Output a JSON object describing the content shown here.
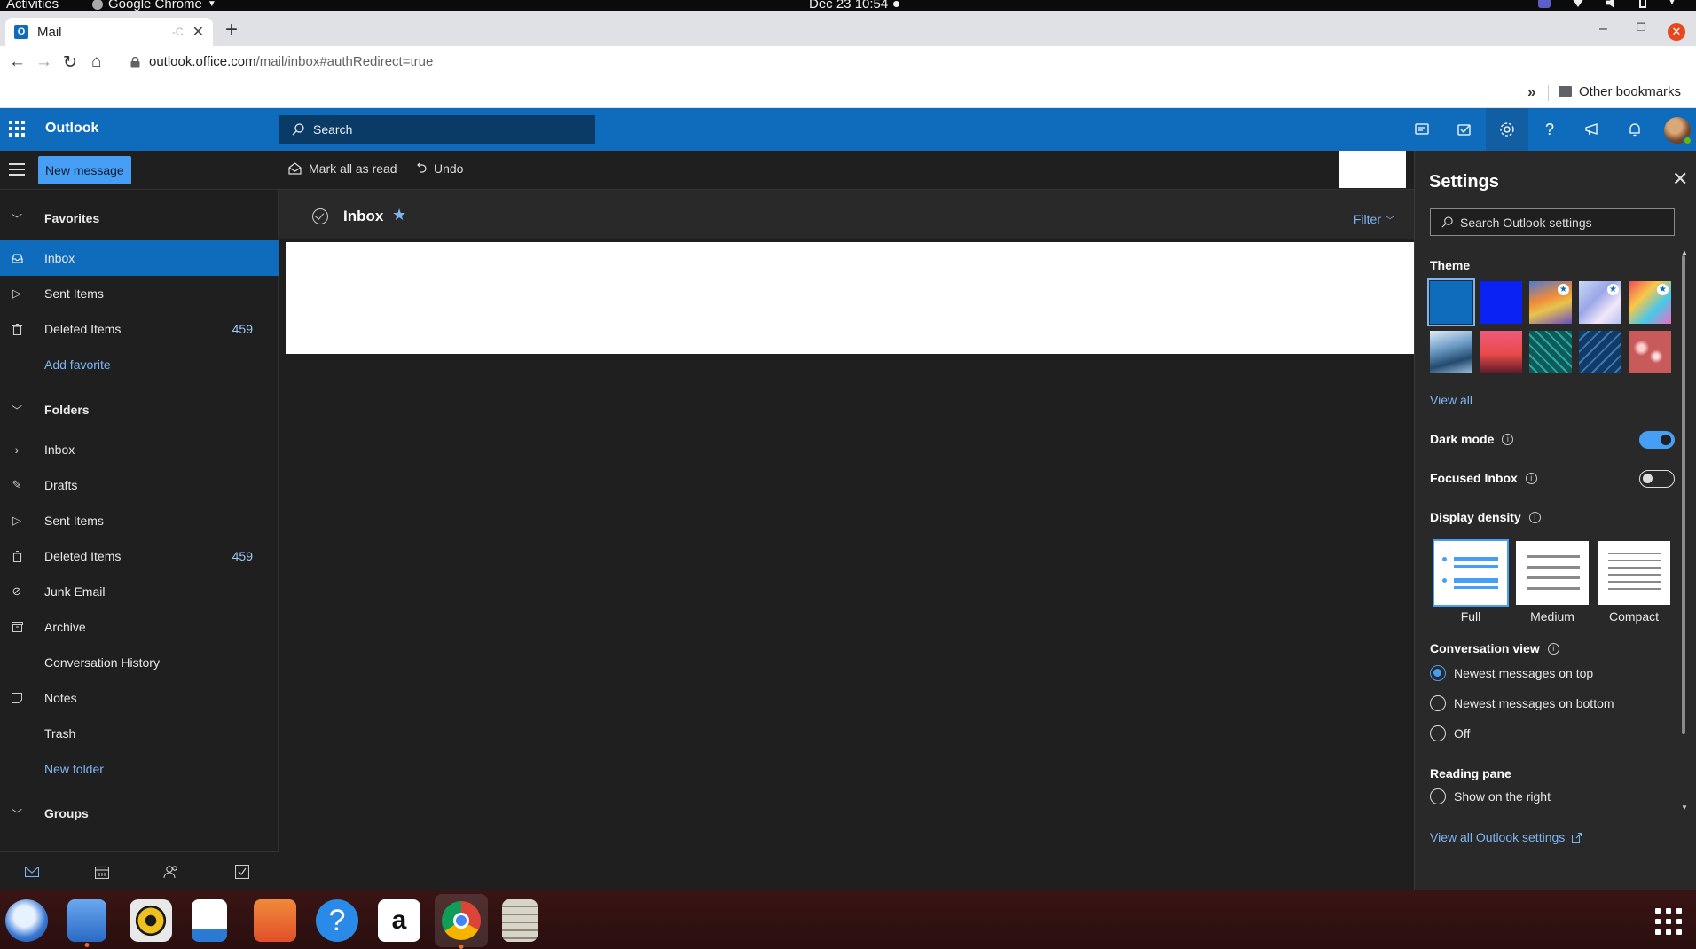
{
  "system_bar": {
    "activities": "Activities",
    "app_name": "Google Chrome",
    "clock": "Dec 23  10:54"
  },
  "browser": {
    "tab_title": "Mail",
    "url_host": "outlook.office.com",
    "url_path": "/mail/inbox#authRedirect=true",
    "bookmarks_overflow": "»",
    "other_bookmarks": "Other bookmarks"
  },
  "outlook": {
    "brand": "Outlook",
    "search_placeholder": "Search",
    "accent_color": "#0f6cbd",
    "header_icons": [
      "my-day-icon",
      "meet-now-icon",
      "settings-icon",
      "help-icon",
      "feedback-icon",
      "notifications-icon"
    ]
  },
  "command_bar": {
    "new_message": "New message",
    "mark_all_read": "Mark all as read",
    "undo": "Undo"
  },
  "nav": {
    "favorites_header": "Favorites",
    "favorites": [
      {
        "label": "Inbox",
        "count": ""
      },
      {
        "label": "Sent Items",
        "count": ""
      },
      {
        "label": "Deleted Items",
        "count": "459"
      }
    ],
    "add_favorite": "Add favorite",
    "folders_header": "Folders",
    "folders": [
      {
        "label": "Inbox",
        "count": ""
      },
      {
        "label": "Drafts",
        "count": ""
      },
      {
        "label": "Sent Items",
        "count": ""
      },
      {
        "label": "Deleted Items",
        "count": "459"
      },
      {
        "label": "Junk Email",
        "count": ""
      },
      {
        "label": "Archive",
        "count": ""
      },
      {
        "label": "Conversation History",
        "count": ""
      },
      {
        "label": "Notes",
        "count": ""
      },
      {
        "label": "Trash",
        "count": ""
      }
    ],
    "new_folder": "New folder",
    "groups_header": "Groups"
  },
  "message_list": {
    "title": "Inbox",
    "filter": "Filter"
  },
  "settings": {
    "title": "Settings",
    "search_placeholder": "Search Outlook settings",
    "theme_label": "Theme",
    "view_all": "View all",
    "dark_mode_label": "Dark mode",
    "dark_mode_on": true,
    "focused_inbox_label": "Focused Inbox",
    "focused_inbox_on": false,
    "display_density_label": "Display density",
    "density_options": [
      "Full",
      "Medium",
      "Compact"
    ],
    "density_selected": "Full",
    "conversation_view_label": "Conversation view",
    "conversation_options": [
      "Newest messages on top",
      "Newest messages on bottom",
      "Off"
    ],
    "conversation_selected": "Newest messages on top",
    "reading_pane_label": "Reading pane",
    "reading_pane_option": "Show on the right",
    "view_all_settings": "View all Outlook settings"
  },
  "dock": {
    "apps": [
      "thunderbird",
      "files",
      "rhythmbox",
      "libreoffice-writer",
      "software-center",
      "help",
      "amazon",
      "chrome",
      "text-editor"
    ],
    "active_app": "chrome"
  }
}
